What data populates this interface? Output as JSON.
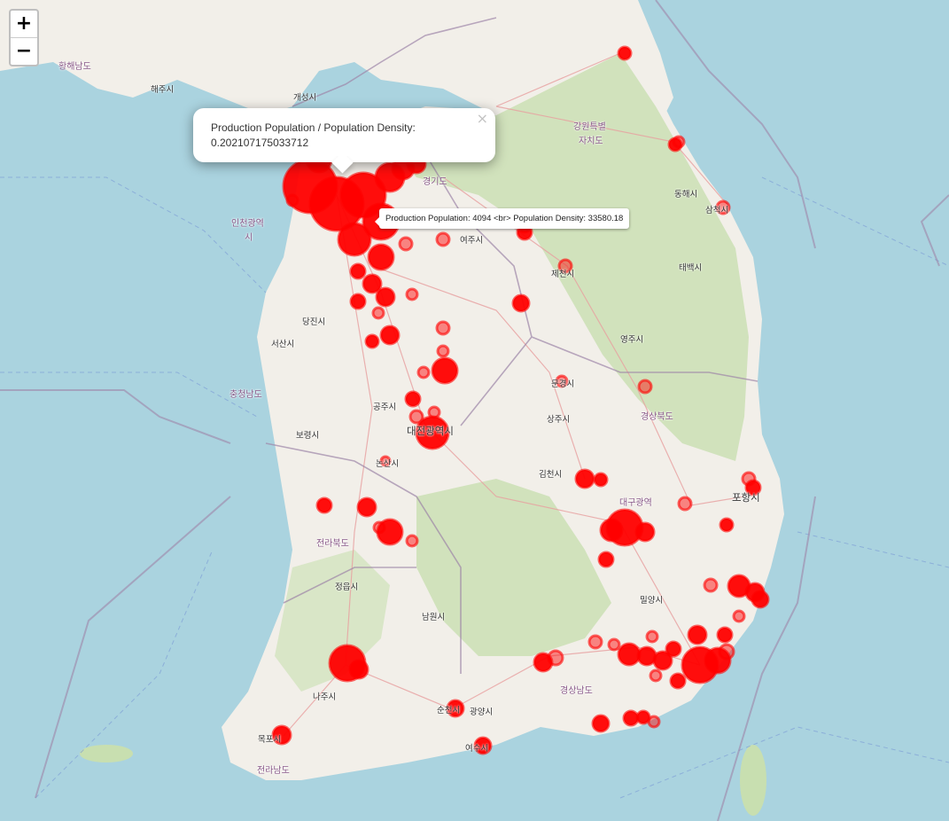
{
  "zoom": {
    "in_label": "+",
    "out_label": "−"
  },
  "popup": {
    "title": "Production Population / Population Density:",
    "value": "0.202107175033712",
    "close_label": "×"
  },
  "tooltip": {
    "text": "Production Population: 4094 <br> Population Density: 33580.18"
  },
  "colors": {
    "sea": "#aad3df",
    "land": "#f2efe9",
    "green": "#c8dfb0",
    "marker": "#ff0000",
    "border": "#9e86a8"
  },
  "labels": [
    {
      "key": "hwanghae",
      "text": "황해남도",
      "region": true
    },
    {
      "key": "haeju",
      "text": "해주시"
    },
    {
      "key": "gaeseong",
      "text": "개성시"
    },
    {
      "key": "gangwon",
      "text": "강원특별",
      "region": true
    },
    {
      "key": "gangwon2",
      "text": "자치도",
      "region": true
    },
    {
      "key": "gyeonggi",
      "text": "경기도",
      "region": true
    },
    {
      "key": "incheon",
      "text": "인천광역",
      "region": true
    },
    {
      "key": "incheon2",
      "text": "시",
      "region": true
    },
    {
      "key": "donghae",
      "text": "동해시"
    },
    {
      "key": "samcheok",
      "text": "삼척시"
    },
    {
      "key": "taebaek",
      "text": "태백시"
    },
    {
      "key": "yeoju",
      "text": "여주시"
    },
    {
      "key": "jecheon",
      "text": "제천시"
    },
    {
      "key": "dangjin",
      "text": "당진시"
    },
    {
      "key": "seosan",
      "text": "서산시"
    },
    {
      "key": "chungnam",
      "text": "충청남도",
      "region": true
    },
    {
      "key": "gongju",
      "text": "공주시"
    },
    {
      "key": "boryeong",
      "text": "보령시"
    },
    {
      "key": "yeongju",
      "text": "영주시"
    },
    {
      "key": "mungyeong",
      "text": "문경시"
    },
    {
      "key": "sangju",
      "text": "상주시"
    },
    {
      "key": "gyeongbuk",
      "text": "경상북도",
      "region": true
    },
    {
      "key": "daejeon",
      "text": "대전광역시",
      "big": true
    },
    {
      "key": "nonsan",
      "text": "논산시"
    },
    {
      "key": "gimcheon",
      "text": "김천시"
    },
    {
      "key": "daegu",
      "text": "대구광역",
      "region": true
    },
    {
      "key": "pohang",
      "text": "포항시",
      "big": true
    },
    {
      "key": "jeonbuk",
      "text": "전라북도",
      "region": true
    },
    {
      "key": "jeongeup",
      "text": "정읍시"
    },
    {
      "key": "namwon",
      "text": "남원시"
    },
    {
      "key": "miryang",
      "text": "밀양시"
    },
    {
      "key": "gyeongnam",
      "text": "경상남도",
      "region": true
    },
    {
      "key": "naju",
      "text": "나주시"
    },
    {
      "key": "suncheon",
      "text": "순천시"
    },
    {
      "key": "gwangyang",
      "text": "광양시"
    },
    {
      "key": "mokpo",
      "text": "목포시"
    },
    {
      "key": "jeonnam",
      "text": "전라남도",
      "region": true
    },
    {
      "key": "yeosu",
      "text": "여수시"
    }
  ]
}
